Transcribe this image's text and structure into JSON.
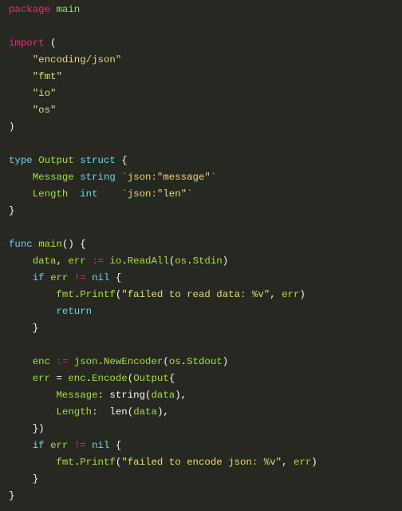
{
  "editor": {
    "language": "go",
    "theme_colors": {
      "background": "#272822",
      "keyword": "#f92672",
      "type": "#66d9ef",
      "identifier": "#a6e22e",
      "string": "#e6db74",
      "punctuation": "#f8f8f2"
    },
    "lines": [
      [
        [
          "kw",
          "package"
        ],
        [
          "pn",
          " "
        ],
        [
          "id",
          "main"
        ]
      ],
      [],
      [
        [
          "kw",
          "import"
        ],
        [
          "pn",
          " ("
        ]
      ],
      [
        [
          "pn",
          "    "
        ],
        [
          "st",
          "\"encoding/json\""
        ]
      ],
      [
        [
          "pn",
          "    "
        ],
        [
          "st",
          "\"fmt\""
        ]
      ],
      [
        [
          "pn",
          "    "
        ],
        [
          "st",
          "\"io\""
        ]
      ],
      [
        [
          "pn",
          "    "
        ],
        [
          "st",
          "\"os\""
        ]
      ],
      [
        [
          "pn",
          ")"
        ]
      ],
      [],
      [
        [
          "ty",
          "type"
        ],
        [
          "pn",
          " "
        ],
        [
          "id",
          "Output"
        ],
        [
          "pn",
          " "
        ],
        [
          "ty",
          "struct"
        ],
        [
          "pn",
          " {"
        ]
      ],
      [
        [
          "pn",
          "    "
        ],
        [
          "id",
          "Message"
        ],
        [
          "pn",
          " "
        ],
        [
          "ty",
          "string"
        ],
        [
          "pn",
          " "
        ],
        [
          "st",
          "`json:\"message\"`"
        ]
      ],
      [
        [
          "pn",
          "    "
        ],
        [
          "id",
          "Length"
        ],
        [
          "pn",
          "  "
        ],
        [
          "ty",
          "int"
        ],
        [
          "pn",
          "    "
        ],
        [
          "st",
          "`json:\"len\"`"
        ]
      ],
      [
        [
          "pn",
          "}"
        ]
      ],
      [],
      [
        [
          "ty",
          "func"
        ],
        [
          "pn",
          " "
        ],
        [
          "id",
          "main"
        ],
        [
          "pn",
          "() {"
        ]
      ],
      [
        [
          "pn",
          "    "
        ],
        [
          "id",
          "data"
        ],
        [
          "pn",
          ", "
        ],
        [
          "id",
          "err"
        ],
        [
          "pn",
          " "
        ],
        [
          "kw",
          ":="
        ],
        [
          "pn",
          " "
        ],
        [
          "id",
          "io"
        ],
        [
          "pn",
          "."
        ],
        [
          "id",
          "ReadAll"
        ],
        [
          "pn",
          "("
        ],
        [
          "id",
          "os"
        ],
        [
          "pn",
          "."
        ],
        [
          "id",
          "Stdin"
        ],
        [
          "pn",
          ")"
        ]
      ],
      [
        [
          "pn",
          "    "
        ],
        [
          "ty",
          "if"
        ],
        [
          "pn",
          " "
        ],
        [
          "id",
          "err"
        ],
        [
          "pn",
          " "
        ],
        [
          "kw",
          "!="
        ],
        [
          "pn",
          " "
        ],
        [
          "ty",
          "nil"
        ],
        [
          "pn",
          " {"
        ]
      ],
      [
        [
          "pn",
          "        "
        ],
        [
          "id",
          "fmt"
        ],
        [
          "pn",
          "."
        ],
        [
          "id",
          "Printf"
        ],
        [
          "pn",
          "("
        ],
        [
          "st",
          "\"failed to read data: %v\""
        ],
        [
          "pn",
          ", "
        ],
        [
          "id",
          "err"
        ],
        [
          "pn",
          ")"
        ]
      ],
      [
        [
          "pn",
          "        "
        ],
        [
          "ty",
          "return"
        ]
      ],
      [
        [
          "pn",
          "    }"
        ]
      ],
      [],
      [
        [
          "pn",
          "    "
        ],
        [
          "id",
          "enc"
        ],
        [
          "pn",
          " "
        ],
        [
          "kw",
          ":="
        ],
        [
          "pn",
          " "
        ],
        [
          "id",
          "json"
        ],
        [
          "pn",
          "."
        ],
        [
          "id",
          "NewEncoder"
        ],
        [
          "pn",
          "("
        ],
        [
          "id",
          "os"
        ],
        [
          "pn",
          "."
        ],
        [
          "id",
          "Stdout"
        ],
        [
          "pn",
          ")"
        ]
      ],
      [
        [
          "pn",
          "    "
        ],
        [
          "id",
          "err"
        ],
        [
          "pn",
          " = "
        ],
        [
          "id",
          "enc"
        ],
        [
          "pn",
          "."
        ],
        [
          "id",
          "Encode"
        ],
        [
          "pn",
          "("
        ],
        [
          "id",
          "Output"
        ],
        [
          "pn",
          "{"
        ]
      ],
      [
        [
          "pn",
          "        "
        ],
        [
          "id",
          "Message"
        ],
        [
          "pn",
          ": string("
        ],
        [
          "id",
          "data"
        ],
        [
          "pn",
          "),"
        ]
      ],
      [
        [
          "pn",
          "        "
        ],
        [
          "id",
          "Length"
        ],
        [
          "pn",
          ":  len("
        ],
        [
          "id",
          "data"
        ],
        [
          "pn",
          "),"
        ]
      ],
      [
        [
          "pn",
          "    })"
        ]
      ],
      [
        [
          "pn",
          "    "
        ],
        [
          "ty",
          "if"
        ],
        [
          "pn",
          " "
        ],
        [
          "id",
          "err"
        ],
        [
          "pn",
          " "
        ],
        [
          "kw",
          "!="
        ],
        [
          "pn",
          " "
        ],
        [
          "ty",
          "nil"
        ],
        [
          "pn",
          " {"
        ]
      ],
      [
        [
          "pn",
          "        "
        ],
        [
          "id",
          "fmt"
        ],
        [
          "pn",
          "."
        ],
        [
          "id",
          "Printf"
        ],
        [
          "pn",
          "("
        ],
        [
          "st",
          "\"failed to encode json: %v\""
        ],
        [
          "pn",
          ", "
        ],
        [
          "id",
          "err"
        ],
        [
          "pn",
          ")"
        ]
      ],
      [
        [
          "pn",
          "    }"
        ]
      ],
      [
        [
          "pn",
          "}"
        ]
      ]
    ]
  }
}
